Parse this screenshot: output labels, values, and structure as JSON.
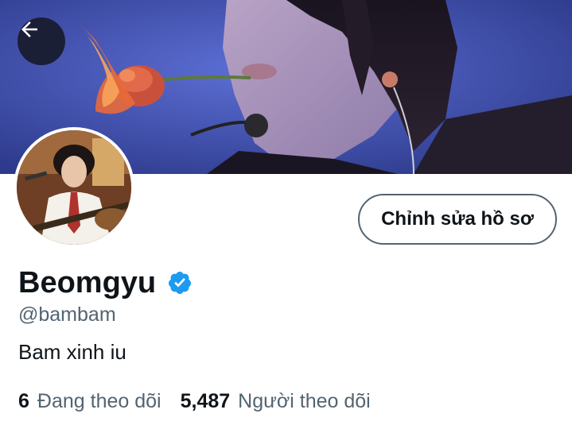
{
  "header": {
    "back_icon": "arrow-left-icon",
    "banner_description_colors": {
      "primary": "#4a5cc4",
      "accent_rose": "#d9523a"
    }
  },
  "profile": {
    "edit_button_label": "Chỉnh sửa hồ sơ",
    "display_name": "Beomgyu",
    "verified_icon": "verified-badge-icon",
    "verified_color": "#1d9bf0",
    "handle": "@bambam",
    "bio": "Bam xinh iu"
  },
  "stats": {
    "following_count": "6",
    "following_label": "Đang theo dõi",
    "followers_count": "5,487",
    "followers_label": "Người theo dõi"
  }
}
